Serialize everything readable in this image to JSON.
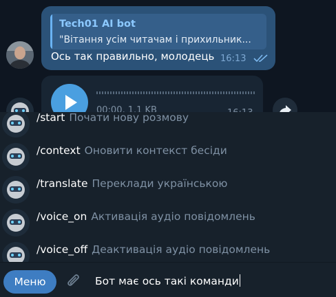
{
  "colors": {
    "background": "#0e1621",
    "outgoing_bubble": "#2b5278",
    "incoming_bubble": "#182533",
    "accent": "#6ab3f3",
    "menu_button": "#3e7dc2",
    "muted_text": "#7f91a4"
  },
  "reply_message": {
    "reply_to_name": "Tech01 AI bot",
    "reply_quote": "\"Вітання усім читачам і прихильник...",
    "text": "Ось так правильно, молодець",
    "time": "16:13",
    "status_icon": "double-check-icon"
  },
  "voice_message": {
    "meta": "00:00, 1.1 KB",
    "time": "16:13",
    "icon": "play-icon"
  },
  "commands": [
    {
      "command": "/start",
      "description": "Почати нову розмову"
    },
    {
      "command": "/context",
      "description": "Оновити контекст бесіди"
    },
    {
      "command": "/translate",
      "description": "Переклади українською"
    },
    {
      "command": "/voice_on",
      "description": "Активація аудіо повідомлень"
    },
    {
      "command": "/voice_off",
      "description": "Деактивація аудіо повідомлень"
    }
  ],
  "composer": {
    "menu_label": "Меню",
    "attach_icon": "paperclip-icon",
    "input_value": "Бот має ось такі команди"
  }
}
